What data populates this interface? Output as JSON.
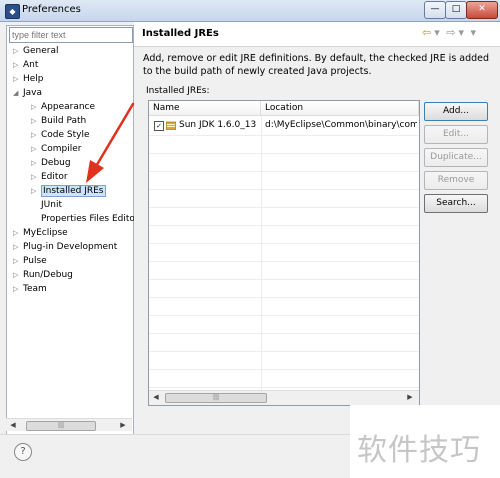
{
  "window": {
    "title": "Preferences",
    "buttons": {
      "minimize": "—",
      "maximize": "□",
      "close": "✕"
    }
  },
  "filter": {
    "placeholder": "type filter text"
  },
  "tree": [
    {
      "label": "General",
      "expanded": false,
      "depth": 0
    },
    {
      "label": "Ant",
      "expanded": false,
      "depth": 0
    },
    {
      "label": "Help",
      "expanded": false,
      "depth": 0
    },
    {
      "label": "Java",
      "expanded": true,
      "depth": 0
    },
    {
      "label": "Appearance",
      "expanded": false,
      "depth": 1
    },
    {
      "label": "Build Path",
      "expanded": false,
      "depth": 1
    },
    {
      "label": "Code Style",
      "expanded": false,
      "depth": 1
    },
    {
      "label": "Compiler",
      "expanded": false,
      "depth": 1
    },
    {
      "label": "Debug",
      "expanded": false,
      "depth": 1
    },
    {
      "label": "Editor",
      "expanded": false,
      "depth": 1
    },
    {
      "label": "Installed JREs",
      "expanded": false,
      "depth": 1,
      "selected": true
    },
    {
      "label": "JUnit",
      "depth": 1
    },
    {
      "label": "Properties Files Edito",
      "depth": 1
    },
    {
      "label": "MyEclipse",
      "expanded": false,
      "depth": 0
    },
    {
      "label": "Plug-in Development",
      "expanded": false,
      "depth": 0
    },
    {
      "label": "Pulse",
      "expanded": false,
      "depth": 0
    },
    {
      "label": "Run/Debug",
      "expanded": false,
      "depth": 0
    },
    {
      "label": "Team",
      "expanded": false,
      "depth": 0
    }
  ],
  "page": {
    "title": "Installed JREs",
    "description": "Add, remove or edit JRE definitions. By default, the checked JRE is added to the build path of newly created Java projects.",
    "installed_label": "Installed JREs:"
  },
  "table": {
    "columns": [
      "Name",
      "Location"
    ],
    "rows": [
      {
        "checked": true,
        "name": "Sun JDK 1.6.0_13",
        "location": "d:\\MyEclipse\\Common\\binary\\com.su"
      }
    ]
  },
  "buttons": {
    "add": "Add...",
    "edit": "Edit...",
    "duplicate": "Duplicate...",
    "remove": "Remove",
    "search": "Search..."
  },
  "help": {
    "icon_glyph": "?"
  },
  "watermark": "软件技巧",
  "colors": {
    "selection": "#cde4fb",
    "annotation_arrow": "#e0301e",
    "nav_arrow": "#c89a2a"
  }
}
